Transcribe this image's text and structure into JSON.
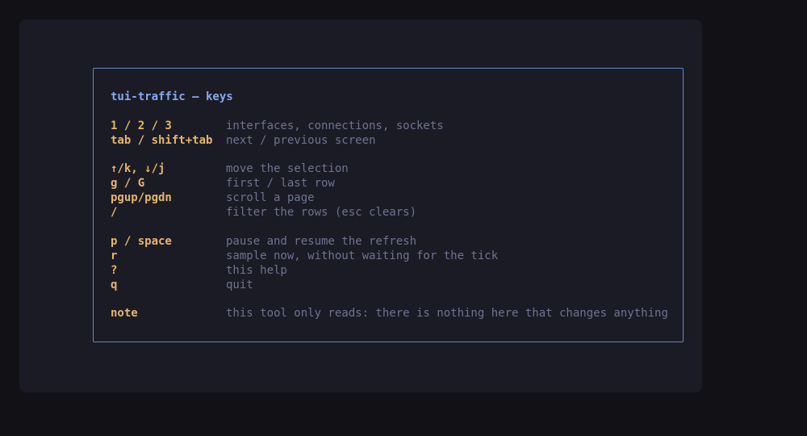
{
  "help": {
    "title": "tui-traffic — keys",
    "groups": [
      {
        "rows": [
          {
            "key": "1 / 2 / 3",
            "desc": "interfaces, connections, sockets"
          },
          {
            "key": "tab / shift+tab",
            "desc": "next / previous screen"
          }
        ]
      },
      {
        "rows": [
          {
            "key": "↑/k, ↓/j",
            "desc": "move the selection"
          },
          {
            "key": "g / G",
            "desc": "first / last row"
          },
          {
            "key": "pgup/pgdn",
            "desc": "scroll a page"
          },
          {
            "key": "/",
            "desc": "filter the rows (esc clears)"
          }
        ]
      },
      {
        "rows": [
          {
            "key": "p / space",
            "desc": "pause and resume the refresh"
          },
          {
            "key": "r",
            "desc": "sample now, without waiting for the tick"
          },
          {
            "key": "?",
            "desc": "this help"
          },
          {
            "key": "q",
            "desc": "quit"
          }
        ]
      },
      {
        "rows": [
          {
            "key": "note",
            "desc": "this tool only reads: there is nothing here that changes anything"
          }
        ]
      }
    ]
  },
  "colors": {
    "title": "#86a8f0",
    "key": "#e5b66c",
    "description": "#6e7391",
    "border": "#6b84c4",
    "background": "#1b1b25"
  }
}
